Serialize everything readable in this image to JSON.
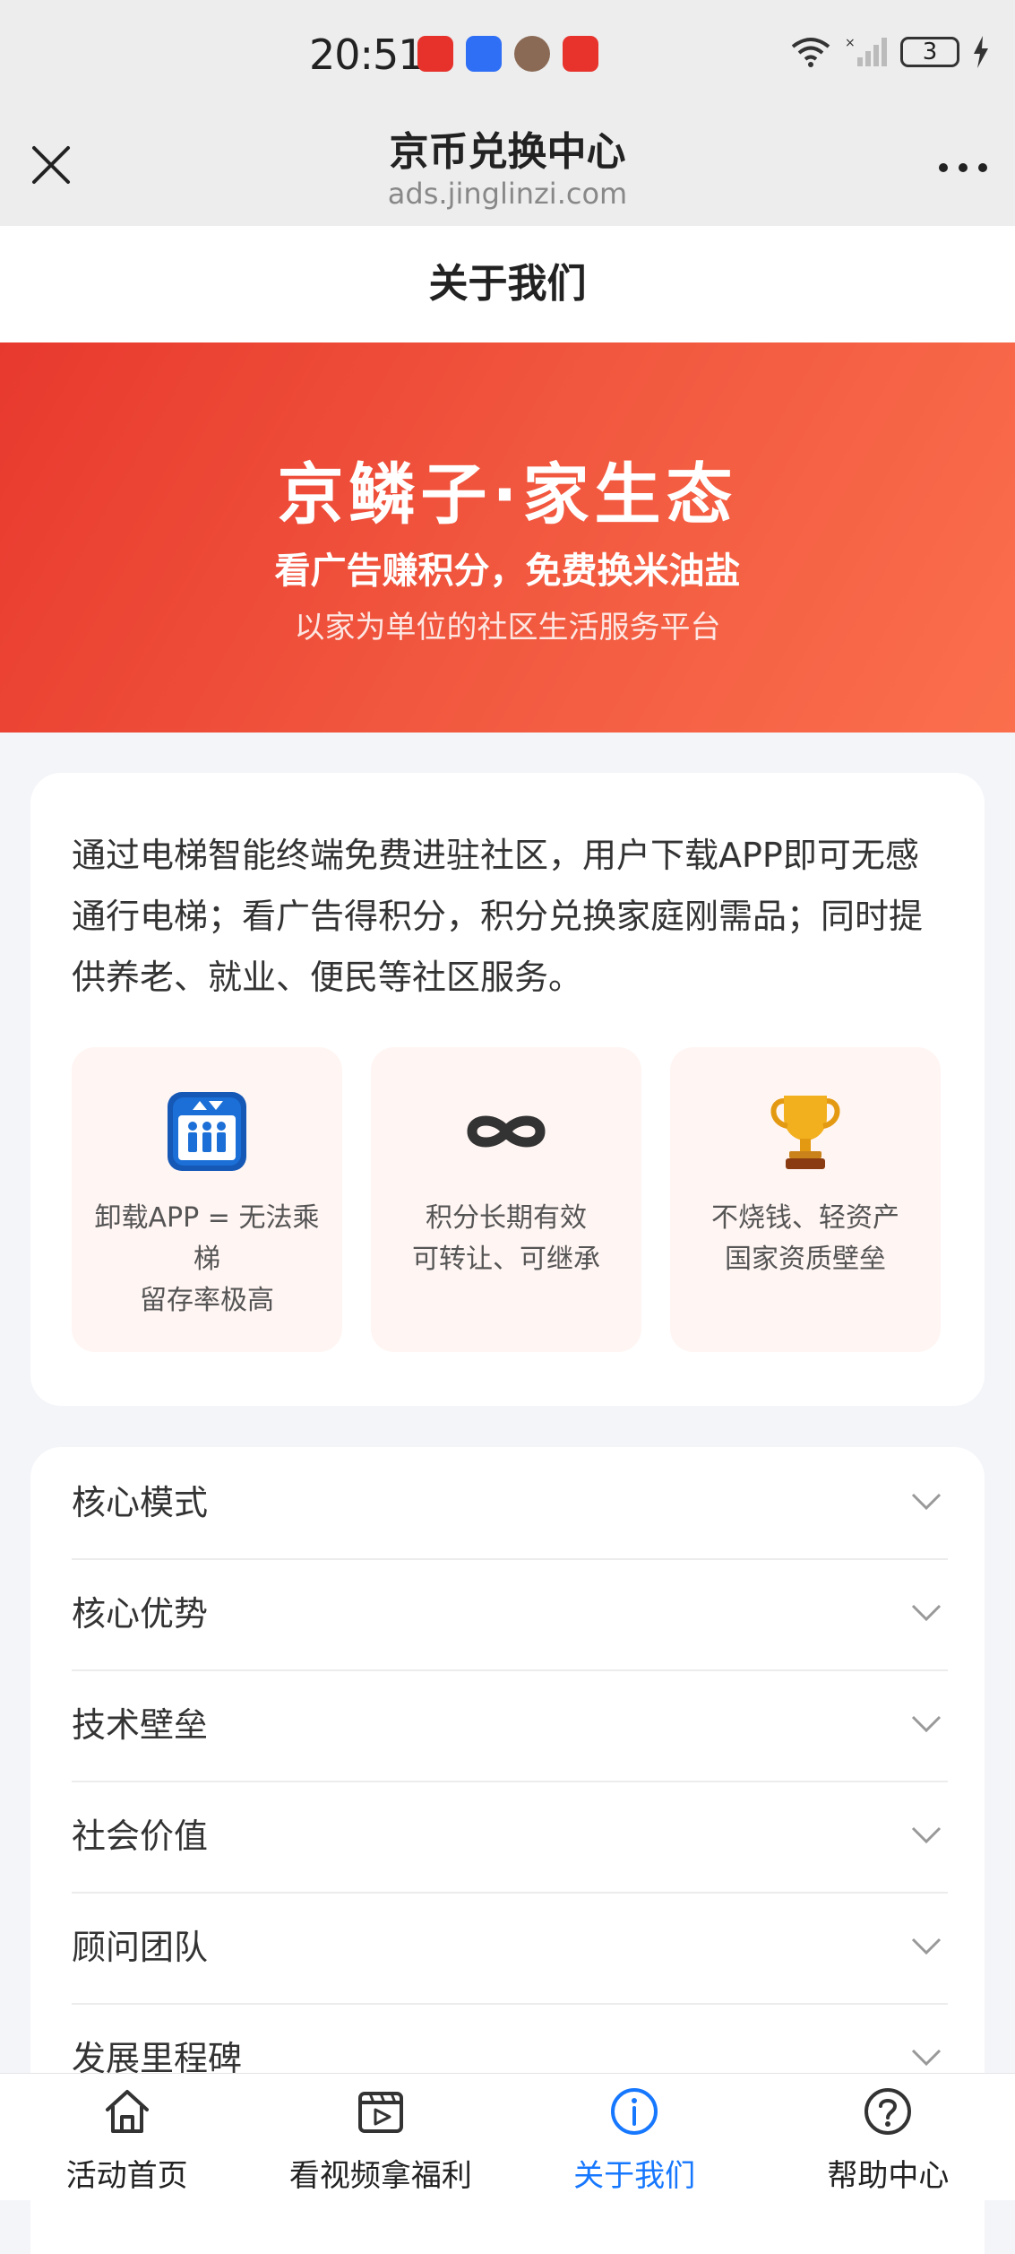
{
  "status_bar": {
    "time": "20:51",
    "battery": "3",
    "network": "6"
  },
  "browser": {
    "title": "京币兑换中心",
    "url": "ads.jinglinzi.com"
  },
  "page": {
    "title": "关于我们"
  },
  "hero": {
    "title": "京鳞子·家生态",
    "subtitle": "看广告赚积分，免费换米油盐",
    "description": "以家为单位的社区生活服务平台"
  },
  "intro": {
    "text": "通过电梯智能终端免费进驻社区，用户下载APP即可无感通行电梯；看广告得积分，积分兑换家庭刚需品；同时提供养老、就业、便民等社区服务。",
    "features": [
      {
        "icon": "elevator-icon",
        "line1": "卸载APP = 无法乘梯",
        "line2": "留存率极高"
      },
      {
        "icon": "infinity-icon",
        "line1": "积分长期有效",
        "line2": "可转让、可继承"
      },
      {
        "icon": "trophy-icon",
        "line1": "不烧钱、轻资产",
        "line2": "国家资质壁垒"
      }
    ]
  },
  "accordion": [
    {
      "label": "核心模式"
    },
    {
      "label": "核心优势"
    },
    {
      "label": "技术壁垒"
    },
    {
      "label": "社会价值"
    },
    {
      "label": "顾问团队"
    },
    {
      "label": "发展里程碑"
    }
  ],
  "bottom_nav": [
    {
      "label": "活动首页",
      "icon": "home-icon"
    },
    {
      "label": "看视频拿福利",
      "icon": "video-icon"
    },
    {
      "label": "关于我们",
      "icon": "info-icon",
      "active": true
    },
    {
      "label": "帮助中心",
      "icon": "help-icon"
    }
  ],
  "colors": {
    "accent": "#1677ff",
    "hero_start": "#e8392e",
    "hero_end": "#fb6f4d",
    "feature_bg": "#fff5f3"
  }
}
